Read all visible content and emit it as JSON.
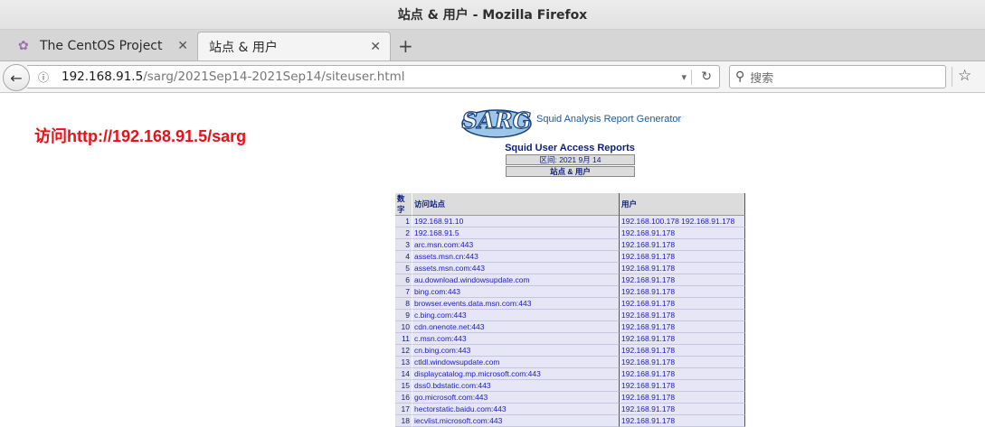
{
  "window": {
    "title": "站点 & 用户 - Mozilla Firefox"
  },
  "tabs": [
    {
      "label": "The CentOS Project"
    },
    {
      "label": "站点 & 用户"
    }
  ],
  "navbar": {
    "url_host": "192.168.91.5",
    "url_path": "/sarg/2021Sep14-2021Sep14/siteuser.html",
    "search_placeholder": "搜索"
  },
  "page": {
    "annotation": "访问http://192.168.91.5/sarg",
    "logo_text": "SARG",
    "logo_caption": "Squid Analysis Report Generator",
    "report_title": "Squid User Access Reports",
    "period": "区间: 2021 9月 14",
    "subtitle": "站点 & 用户",
    "columns": {
      "num": "数字",
      "site": "访问站点",
      "user": "用户"
    },
    "rows": [
      {
        "num": "1",
        "site": "192.168.91.10",
        "user": "192.168.100.178 192.168.91.178"
      },
      {
        "num": "2",
        "site": "192.168.91.5",
        "user": "192.168.91.178"
      },
      {
        "num": "3",
        "site": "arc.msn.com:443",
        "user": "192.168.91.178"
      },
      {
        "num": "4",
        "site": "assets.msn.cn:443",
        "user": "192.168.91.178"
      },
      {
        "num": "5",
        "site": "assets.msn.com:443",
        "user": "192.168.91.178"
      },
      {
        "num": "6",
        "site": "au.download.windowsupdate.com",
        "user": "192.168.91.178"
      },
      {
        "num": "7",
        "site": "bing.com:443",
        "user": "192.168.91.178"
      },
      {
        "num": "8",
        "site": "browser.events.data.msn.com:443",
        "user": "192.168.91.178"
      },
      {
        "num": "9",
        "site": "c.bing.com:443",
        "user": "192.168.91.178"
      },
      {
        "num": "10",
        "site": "cdn.onenote.net:443",
        "user": "192.168.91.178"
      },
      {
        "num": "11",
        "site": "c.msn.com:443",
        "user": "192.168.91.178"
      },
      {
        "num": "12",
        "site": "cn.bing.com:443",
        "user": "192.168.91.178"
      },
      {
        "num": "13",
        "site": "ctldl.windowsupdate.com",
        "user": "192.168.91.178"
      },
      {
        "num": "14",
        "site": "displaycatalog.mp.microsoft.com:443",
        "user": "192.168.91.178"
      },
      {
        "num": "15",
        "site": "dss0.bdstatic.com:443",
        "user": "192.168.91.178"
      },
      {
        "num": "16",
        "site": "go.microsoft.com:443",
        "user": "192.168.91.178"
      },
      {
        "num": "17",
        "site": "hectorstatic.baidu.com:443",
        "user": "192.168.91.178"
      },
      {
        "num": "18",
        "site": "iecvlist.microsoft.com:443",
        "user": "192.168.91.178"
      }
    ]
  }
}
